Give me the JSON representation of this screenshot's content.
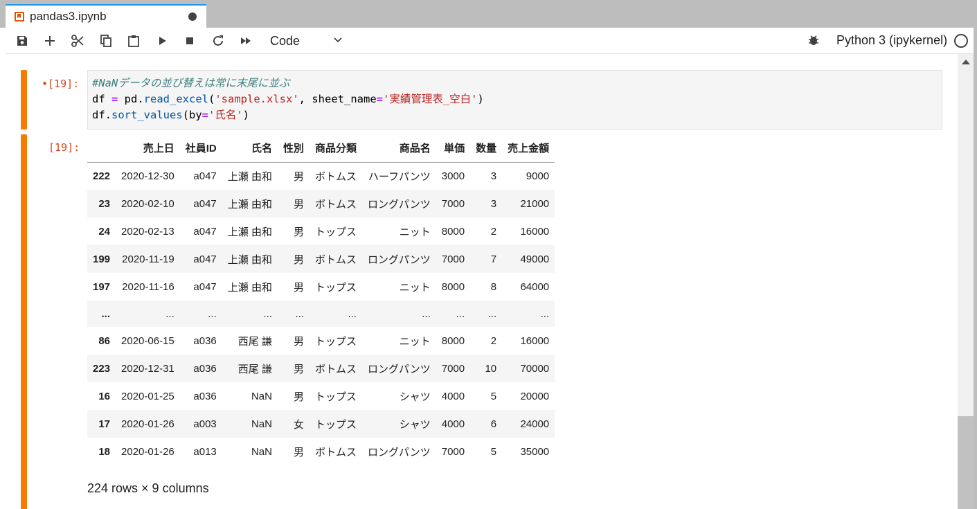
{
  "tab": {
    "title": "pandas3.ipynb"
  },
  "toolbar": {
    "cell_type": "Code",
    "kernel_name": "Python 3 (ipykernel)",
    "buttons": [
      "save-icon",
      "add-icon",
      "cut-icon",
      "copy-icon",
      "paste-icon",
      "run-icon",
      "stop-icon",
      "restart-icon",
      "fast-forward-icon"
    ]
  },
  "input_cell": {
    "prompt": "•[19]:",
    "code_line1_comment": "#NaNデータの並び替えは常に末尾に並ぶ",
    "code_line2": {
      "a": "df ",
      "op": "=",
      "b": " pd.",
      "fn": "read_excel",
      "c": "(",
      "s1": "'sample.xlsx'",
      "d": ", sheet_name",
      "op2": "=",
      "s2": "'実績管理表_空白'",
      "e": ")"
    },
    "code_line3": {
      "a": "df.",
      "fn": "sort_values",
      "b": "(by",
      "op": "=",
      "s": "'氏名'",
      "c": ")"
    }
  },
  "output_cell": {
    "prompt": "[19]:",
    "columns": [
      "",
      "売上日",
      "社員ID",
      "氏名",
      "性別",
      "商品分類",
      "商品名",
      "単価",
      "数量",
      "売上金額"
    ],
    "rows": [
      [
        "222",
        "2020-12-30",
        "a047",
        "上瀬 由和",
        "男",
        "ボトムス",
        "ハーフパンツ",
        "3000",
        "3",
        "9000"
      ],
      [
        "23",
        "2020-02-10",
        "a047",
        "上瀬 由和",
        "男",
        "ボトムス",
        "ロングパンツ",
        "7000",
        "3",
        "21000"
      ],
      [
        "24",
        "2020-02-13",
        "a047",
        "上瀬 由和",
        "男",
        "トップス",
        "ニット",
        "8000",
        "2",
        "16000"
      ],
      [
        "199",
        "2020-11-19",
        "a047",
        "上瀬 由和",
        "男",
        "ボトムス",
        "ロングパンツ",
        "7000",
        "7",
        "49000"
      ],
      [
        "197",
        "2020-11-16",
        "a047",
        "上瀬 由和",
        "男",
        "トップス",
        "ニット",
        "8000",
        "8",
        "64000"
      ],
      [
        "...",
        "...",
        "...",
        "...",
        "...",
        "...",
        "...",
        "...",
        "...",
        "..."
      ],
      [
        "86",
        "2020-06-15",
        "a036",
        "西尾 謙",
        "男",
        "トップス",
        "ニット",
        "8000",
        "2",
        "16000"
      ],
      [
        "223",
        "2020-12-31",
        "a036",
        "西尾 謙",
        "男",
        "ボトムス",
        "ロングパンツ",
        "7000",
        "10",
        "70000"
      ],
      [
        "16",
        "2020-01-25",
        "a036",
        "NaN",
        "男",
        "トップス",
        "シャツ",
        "4000",
        "5",
        "20000"
      ],
      [
        "17",
        "2020-01-26",
        "a003",
        "NaN",
        "女",
        "トップス",
        "シャツ",
        "4000",
        "6",
        "24000"
      ],
      [
        "18",
        "2020-01-26",
        "a013",
        "NaN",
        "男",
        "ボトムス",
        "ロングパンツ",
        "7000",
        "5",
        "35000"
      ]
    ],
    "shape_text": "224 rows × 9 columns"
  },
  "colors": {
    "accent_orange": "#f57c00",
    "tab_top_border": "#2196f3",
    "prompt": "#d84315"
  }
}
